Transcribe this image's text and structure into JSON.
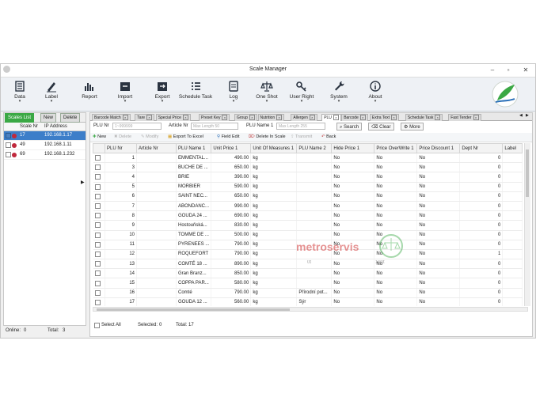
{
  "window": {
    "title": "Scale Manager"
  },
  "ribbon": [
    {
      "label": "Data",
      "icon": "data-icon",
      "dropdown": true
    },
    {
      "label": "Label",
      "icon": "pen-icon",
      "dropdown": true
    },
    {
      "label": "Report",
      "icon": "bar-chart-icon",
      "dropdown": false
    },
    {
      "label": "Import",
      "icon": "import-icon",
      "dropdown": true
    },
    {
      "label": "Export",
      "icon": "export-icon",
      "dropdown": true
    },
    {
      "label": "Schedule Task",
      "icon": "list-icon",
      "dropdown": false
    },
    {
      "label": "Log",
      "icon": "log-icon",
      "dropdown": true
    },
    {
      "label": "One Shot",
      "icon": "scale-icon",
      "dropdown": true
    },
    {
      "label": "User Right",
      "icon": "key-icon",
      "dropdown": true
    },
    {
      "label": "System",
      "icon": "wrench-icon",
      "dropdown": true
    },
    {
      "label": "About",
      "icon": "info-icon",
      "dropdown": true
    }
  ],
  "left": {
    "tabs": [
      "Scales List",
      "New",
      "Delete"
    ],
    "headers": [
      "Scale Nr",
      "IP Address"
    ],
    "rows": [
      {
        "nr": "17",
        "ip": "192.168.1.17",
        "checked": true,
        "selected": true
      },
      {
        "nr": "49",
        "ip": "192.168.1.11",
        "checked": false,
        "selected": false
      },
      {
        "nr": "69",
        "ip": "192.168.1.232",
        "checked": false,
        "selected": false
      }
    ],
    "online_label": "Online:",
    "online": "0",
    "total_label": "Total:",
    "total": "3"
  },
  "tabs": [
    "Barcode Match",
    "Tare",
    "Special Price",
    "Preset Key",
    "Group",
    "Nutrition",
    "Allergen",
    "PLU",
    "Barcode",
    "Extra Text",
    "Schedule Task",
    "Fast Tender"
  ],
  "active_tab": "PLU",
  "search": {
    "plu_label": "PLU Nr",
    "plu_placeholder": "1~999999",
    "article_label": "Article Nr",
    "article_placeholder": "Max Length 50",
    "name_label": "PLU Name 1",
    "name_placeholder": "Max Length 255",
    "search_btn": "Search",
    "clear_btn": "Clear",
    "more_btn": "More"
  },
  "toolbar": [
    "New",
    "Delete",
    "Modify",
    "Export To Excel",
    "Field Edit",
    "Delete In Scale",
    "Transmit",
    "Back"
  ],
  "columns": [
    "PLU Nr",
    "Article Nr",
    "PLU Name 1",
    "Unit Price 1",
    "Unit Of Measures 1",
    "PLU Name 2",
    "Hide Price 1",
    "Price OverWrite 1",
    "Price Discount 1",
    "Dept Nr",
    "Label"
  ],
  "rows": [
    {
      "plu": "1",
      "name1": "EMMENTAL...",
      "price": "490.00",
      "uom": "kg",
      "name2": "",
      "hide": "No",
      "ow": "No",
      "disc": "No",
      "dept": "0"
    },
    {
      "plu": "3",
      "name1": "BUCHE DE ...",
      "price": "650.00",
      "uom": "kg",
      "name2": "",
      "hide": "No",
      "ow": "No",
      "disc": "No",
      "dept": "0"
    },
    {
      "plu": "4",
      "name1": "BRIE",
      "price": "390.00",
      "uom": "kg",
      "name2": "",
      "hide": "No",
      "ow": "No",
      "disc": "No",
      "dept": "0"
    },
    {
      "plu": "5",
      "name1": "MORBIER",
      "price": "590.00",
      "uom": "kg",
      "name2": "",
      "hide": "No",
      "ow": "No",
      "disc": "No",
      "dept": "0"
    },
    {
      "plu": "6",
      "name1": "SAINT NEC...",
      "price": "650.00",
      "uom": "kg",
      "name2": "",
      "hide": "No",
      "ow": "No",
      "disc": "No",
      "dept": "0"
    },
    {
      "plu": "7",
      "name1": "ABONDANC...",
      "price": "990.00",
      "uom": "kg",
      "name2": "",
      "hide": "No",
      "ow": "No",
      "disc": "No",
      "dept": "0"
    },
    {
      "plu": "8",
      "name1": "GOUDA 24 ...",
      "price": "690.00",
      "uom": "kg",
      "name2": "",
      "hide": "No",
      "ow": "No",
      "disc": "No",
      "dept": "0"
    },
    {
      "plu": "9",
      "name1": "Hostouňská...",
      "price": "830.00",
      "uom": "kg",
      "name2": "",
      "hide": "No",
      "ow": "No",
      "disc": "No",
      "dept": "0"
    },
    {
      "plu": "10",
      "name1": "TOMME DE ...",
      "price": "500.00",
      "uom": "kg",
      "name2": "",
      "hide": "No",
      "ow": "No",
      "disc": "No",
      "dept": "0"
    },
    {
      "plu": "11",
      "name1": "PYRENEES ...",
      "price": "790.00",
      "uom": "kg",
      "name2": "",
      "hide": "No",
      "ow": "No",
      "disc": "No",
      "dept": "0"
    },
    {
      "plu": "12",
      "name1": "ROQUEFORT",
      "price": "790.00",
      "uom": "kg",
      "name2": "",
      "hide": "No",
      "ow": "No",
      "disc": "No",
      "dept": "1"
    },
    {
      "plu": "13",
      "name1": "COMTÉ 18 ...",
      "price": "890.00",
      "uom": "kg",
      "name2": "",
      "hide": "No",
      "ow": "No",
      "disc": "No",
      "dept": "0"
    },
    {
      "plu": "14",
      "name1": "Gran Branz...",
      "price": "850.00",
      "uom": "kg",
      "name2": "",
      "hide": "No",
      "ow": "No",
      "disc": "No",
      "dept": "0"
    },
    {
      "plu": "15",
      "name1": "COPPA PAR...",
      "price": "580.00",
      "uom": "kg",
      "name2": "",
      "hide": "No",
      "ow": "No",
      "disc": "No",
      "dept": "0"
    },
    {
      "plu": "16",
      "name1": "Comté",
      "price": "790.00",
      "uom": "kg",
      "name2": "Přírodní pot...",
      "hide": "No",
      "ow": "No",
      "disc": "No",
      "dept": "0"
    },
    {
      "plu": "17",
      "name1": "GOUDA 12 ...",
      "price": "560.00",
      "uom": "kg",
      "name2": "Sýr",
      "hide": "No",
      "ow": "No",
      "disc": "No",
      "dept": "0"
    }
  ],
  "footer": {
    "select_all": "Select All",
    "selected_label": "Selected:",
    "selected": "0",
    "total_label": "Total:",
    "total": "17"
  },
  "watermark": {
    "text": "metroservis",
    "sub1": "0t",
    "sub2": "100t"
  },
  "colors": {
    "active_green": "#3aa844",
    "selection_blue": "#3d7ec9",
    "status_red": "#c0283c",
    "watermark_red": "#d23a3a"
  }
}
